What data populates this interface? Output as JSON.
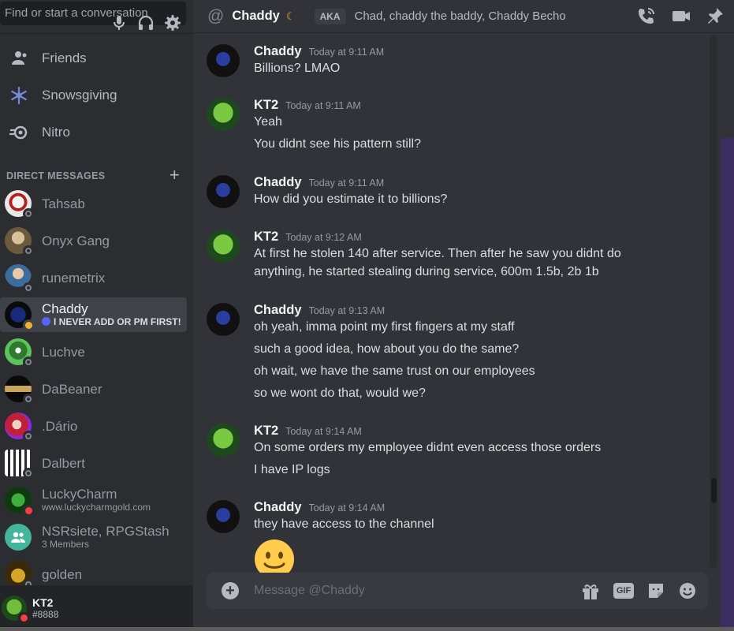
{
  "search": {
    "placeholder": "Find or start a conversation"
  },
  "nav": [
    {
      "label": "Friends",
      "icon": "friends-icon"
    },
    {
      "label": "Snowsgiving",
      "icon": "snowflake-icon"
    },
    {
      "label": "Nitro",
      "icon": "nitro-icon"
    }
  ],
  "dm_header": {
    "label": "DIRECT MESSAGES",
    "add": "+"
  },
  "dms": [
    {
      "name": "Tahsab",
      "subtitle": "",
      "status": "offline"
    },
    {
      "name": "Onyx Gang",
      "subtitle": "",
      "status": "offline"
    },
    {
      "name": "runemetrix",
      "subtitle": "",
      "status": "offline"
    },
    {
      "name": "Chaddy",
      "subtitle": "I NEVER ADD OR PM FIRST!",
      "status": "idle"
    },
    {
      "name": "Luchve",
      "subtitle": "",
      "status": "offline"
    },
    {
      "name": "DaBeaner",
      "subtitle": "",
      "status": "offline"
    },
    {
      "name": ".Dário",
      "subtitle": "",
      "status": "offline"
    },
    {
      "name": "Dalbert",
      "subtitle": "",
      "status": "offline"
    },
    {
      "name": "LuckyCharm",
      "subtitle": "www.luckycharmgold.com",
      "status": "dnd"
    },
    {
      "name": "NSRsiete, RPGStash",
      "subtitle": "3 Members",
      "status": ""
    },
    {
      "name": "golden",
      "subtitle": "",
      "status": "offline"
    }
  ],
  "user": {
    "name": "KT2",
    "tag": "#8888"
  },
  "header": {
    "at": "@",
    "name": "Chaddy",
    "aka_badge": "AKA",
    "aka_names": "Chad, chaddy the baddy, Chaddy Becho"
  },
  "messages": [
    {
      "author": "Chaddy",
      "time": "Today at 9:11 AM",
      "lines": [
        "Billions? LMAO"
      ]
    },
    {
      "author": "KT2",
      "time": "Today at 9:11 AM",
      "lines": [
        "Yeah",
        "You didnt see his pattern still?"
      ]
    },
    {
      "author": "Chaddy",
      "time": "Today at 9:11 AM",
      "lines": [
        "How did you estimate it to billions?"
      ]
    },
    {
      "author": "KT2",
      "time": "Today at 9:12 AM",
      "lines": [
        "At first he stolen 140 after service. Then after he saw you didnt do",
        "anything, he started stealing during service, 600m 1.5b, 2b 1b"
      ]
    },
    {
      "author": "Chaddy",
      "time": "Today at 9:13 AM",
      "lines": [
        "oh yeah, imma point my first fingers at my staff",
        "such a good idea, how about you do the same?",
        "oh wait, we have the same trust on our employees",
        "so we wont do that, would we?"
      ]
    },
    {
      "author": "KT2",
      "time": "Today at 9:14 AM",
      "lines": [
        "On some orders my employee didnt even access those orders",
        "I have IP logs"
      ]
    },
    {
      "author": "Chaddy",
      "time": "Today at 9:14 AM",
      "lines": [
        "they have access to the channel"
      ]
    }
  ],
  "composer": {
    "placeholder": "Message @Chaddy",
    "gif": "GIF"
  },
  "colors": {
    "accent": "#5865f2",
    "idle": "#f0b232",
    "dnd": "#f23f43",
    "background": "#313338"
  }
}
